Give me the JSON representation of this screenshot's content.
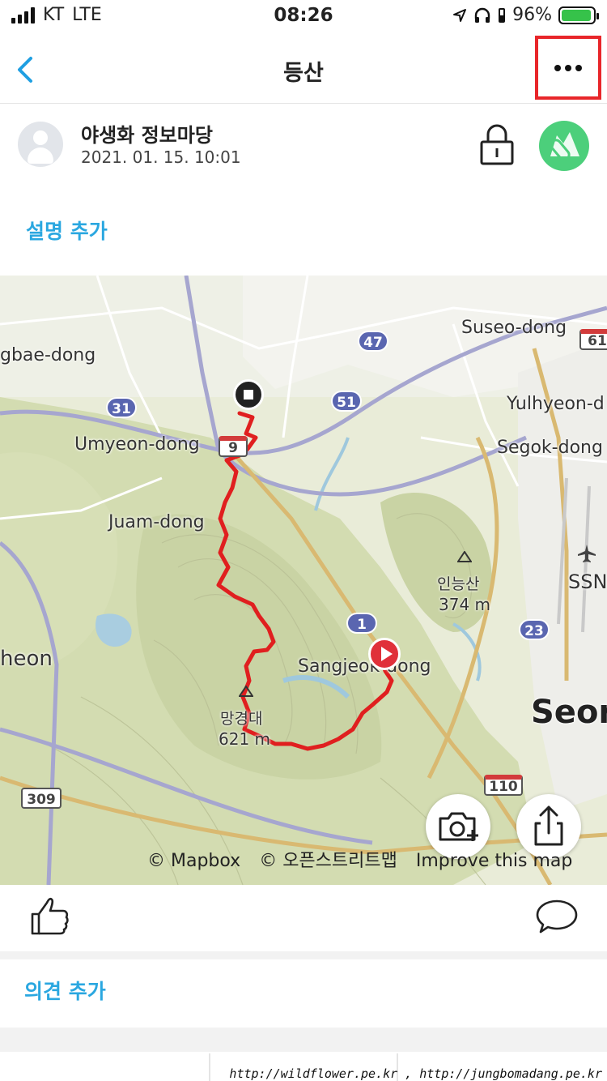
{
  "status_bar": {
    "carrier": "KT",
    "network": "LTE",
    "time": "08:26",
    "battery": "96%",
    "battery_level": 0.96
  },
  "nav": {
    "title": "등산",
    "back_icon": "chevron-left-icon",
    "more_icon": "more-horizontal-icon"
  },
  "post": {
    "author": "야생화 정보마당",
    "date": "2021. 01. 15. 10:01",
    "lock_icon": "lock-icon",
    "activity_icon": "hiking-carabiner-icon"
  },
  "description": {
    "add_label": "설명 추가"
  },
  "map": {
    "places": {
      "suseo": "Suseo-dong",
      "gaebae": "gbae-dong",
      "yulhyeon": "Yulhyeon-d",
      "umyeon": "Umyeon-dong",
      "segok": "Segok-dong",
      "juam": "Juam-dong",
      "ssn": "SSN",
      "gwacheon": "heon",
      "sangjeok": "Sangjeok-dong",
      "seongnam": "Seor"
    },
    "peaks": [
      {
        "name": "인능산",
        "elevation": "374 m"
      },
      {
        "name": "망경대",
        "elevation": "621 m"
      }
    ],
    "shields": {
      "r47": "47",
      "r61": "61",
      "r31": "31",
      "r51": "51",
      "r9": "9",
      "r1": "1",
      "r23": "23",
      "r110": "110",
      "r309": "309"
    },
    "credits": {
      "mapbox": "© Mapbox",
      "osm": "© 오픈스트리트맵",
      "improve": "Improve this map"
    },
    "track_color": "#e01f1f"
  },
  "actions": {
    "like_icon": "thumbs-up-icon",
    "comment_icon": "comment-bubble-icon",
    "add_comment_label": "의견 추가"
  },
  "watermark": "http://wildflower.pe.kr , http://jungbomadang.pe.kr"
}
